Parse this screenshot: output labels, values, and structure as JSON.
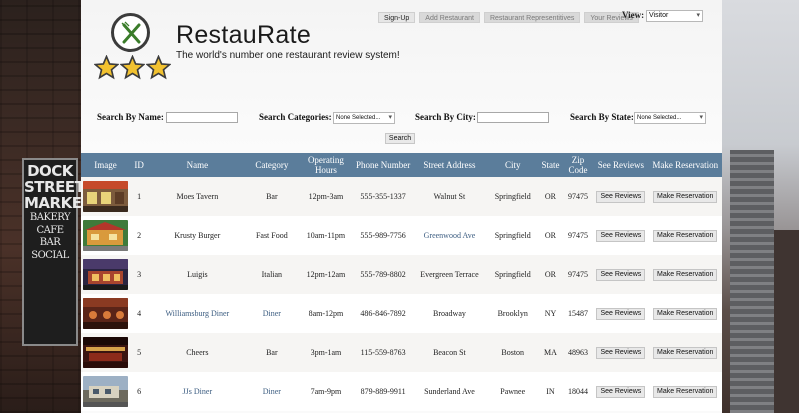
{
  "background": {
    "sign_lines": [
      "DOCK",
      "STREET",
      "MARKET",
      "BAKERY",
      "CAFE",
      "BAR",
      "SOCIAL"
    ]
  },
  "brand": {
    "title": "RestauRate",
    "tagline": "The world's number one restaurant review system!",
    "stars": 3,
    "accent": "#f2c230"
  },
  "nav": {
    "buttons": [
      "Sign-Up",
      "Add Restaurant",
      "Restaurant Representitives",
      "Your Reviews"
    ],
    "view_label": "View:",
    "view_value": "Visitor"
  },
  "search": {
    "name_label": "Search By Name:",
    "name_value": "",
    "categories_label": "Search Categories:",
    "categories_value": "None Selected...",
    "city_label": "Search By City:",
    "city_value": "",
    "state_label": "Search By State:",
    "state_value": "None Selected...",
    "button": "Search"
  },
  "table": {
    "header_color": "#5b7d9b",
    "headers": [
      "Image",
      "ID",
      "Name",
      "Category",
      "Operating Hours",
      "Phone Number",
      "Street Address",
      "City",
      "State",
      "Zip Code",
      "See Reviews",
      "Make Reservation"
    ],
    "rows": [
      {
        "id": "1",
        "name": "Moes Tavern",
        "category": "Bar",
        "hours": "12pm-3am",
        "phone": "555-355-1337",
        "address": "Walnut St",
        "city": "Springfield",
        "state": "OR",
        "zip": "97475",
        "reviews_btn": "See Reviews",
        "reserve_btn": "Make Reservation",
        "thumb": "tavern"
      },
      {
        "id": "2",
        "name": "Krusty Burger",
        "category": "Fast Food",
        "hours": "10am-11pm",
        "phone": "555-989-7756",
        "address": "Greenwood Ave",
        "city": "Springfield",
        "state": "OR",
        "zip": "97475",
        "reviews_btn": "See Reviews",
        "reserve_btn": "Make Reservation",
        "thumb": "burger"
      },
      {
        "id": "3",
        "name": "Luigis",
        "category": "Italian",
        "hours": "12pm-12am",
        "phone": "555-789-8802",
        "address": "Evergreen Terrace",
        "city": "Springfield",
        "state": "OR",
        "zip": "97475",
        "reviews_btn": "See Reviews",
        "reserve_btn": "Make Reservation",
        "thumb": "italian"
      },
      {
        "id": "4",
        "name": "Williamsburg Diner",
        "category": "Diner",
        "hours": "8am-12pm",
        "phone": "486-846-7892",
        "address": "Broadway",
        "city": "Brooklyn",
        "state": "NY",
        "zip": "15487",
        "reviews_btn": "See Reviews",
        "reserve_btn": "Make Reservation",
        "thumb": "diner"
      },
      {
        "id": "5",
        "name": "Cheers",
        "category": "Bar",
        "hours": "3pm-1am",
        "phone": "115-559-8763",
        "address": "Beacon St",
        "city": "Boston",
        "state": "MA",
        "zip": "48963",
        "reviews_btn": "See Reviews",
        "reserve_btn": "Make Reservation",
        "thumb": "cheers"
      },
      {
        "id": "6",
        "name": "JJs Diner",
        "category": "Diner",
        "hours": "7am-9pm",
        "phone": "879-889-9911",
        "address": "Sunderland Ave",
        "city": "Pawnee",
        "state": "IN",
        "zip": "18044",
        "reviews_btn": "See Reviews",
        "reserve_btn": "Make Reservation",
        "thumb": "jjs"
      }
    ]
  }
}
